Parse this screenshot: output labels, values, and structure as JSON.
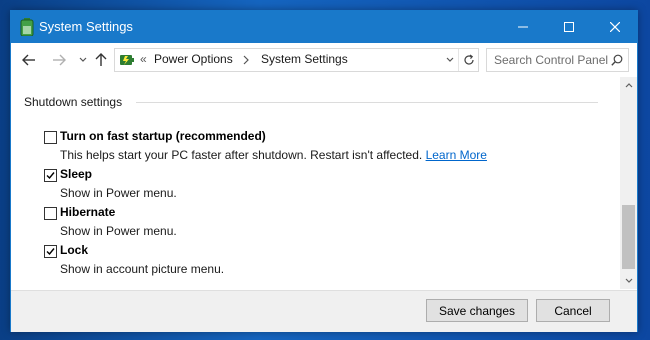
{
  "window": {
    "title": "System Settings"
  },
  "address": {
    "breadcrumbs": [
      "Power Options",
      "System Settings"
    ],
    "overflow_marker": "«",
    "search_placeholder": "Search Control Panel"
  },
  "section": {
    "title": "Shutdown settings"
  },
  "options": [
    {
      "label": "Turn on fast startup (recommended)",
      "checked": false,
      "description": "This helps start your PC faster after shutdown. Restart isn't affected.",
      "link": "Learn More"
    },
    {
      "label": "Sleep",
      "checked": true,
      "description": "Show in Power menu."
    },
    {
      "label": "Hibernate",
      "checked": false,
      "description": "Show in Power menu."
    },
    {
      "label": "Lock",
      "checked": true,
      "description": "Show in account picture menu."
    }
  ],
  "footer": {
    "save_label": "Save changes",
    "cancel_label": "Cancel"
  },
  "colors": {
    "titlebar": "#1979ca",
    "link": "#0066cc",
    "desktop": "#1565c0"
  },
  "icons": [
    "battery-icon",
    "minimize-icon",
    "maximize-icon",
    "close-icon",
    "back-arrow-icon",
    "forward-arrow-icon",
    "recent-dropdown-icon",
    "up-arrow-icon",
    "power-options-icon",
    "chevron-right-icon",
    "refresh-icon",
    "search-icon",
    "checkmark-icon",
    "scroll-up-icon",
    "scroll-down-icon"
  ]
}
